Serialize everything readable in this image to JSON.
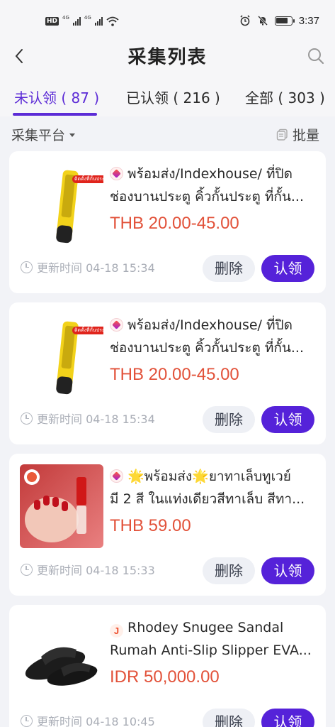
{
  "status_bar": {
    "hd": "HD",
    "net1": "4G",
    "net2": "4G",
    "time": "3:37",
    "battery_level": 0.8
  },
  "header": {
    "title": "采集列表",
    "back_icon": "chevron-left-icon",
    "search_icon": "search-icon"
  },
  "tabs": [
    {
      "label": "未认领 ( 87 )",
      "active": true
    },
    {
      "label": "已认领 ( 216 )",
      "active": false
    },
    {
      "label": "全部 ( 303 )",
      "active": false
    }
  ],
  "filter": {
    "platform_label": "采集平台",
    "batch_label": "批量"
  },
  "accent_color": "#5522d9",
  "price_color": "#e2523a",
  "items": [
    {
      "platform_icon": "lazada-icon",
      "title_line1": "พร้อมส่ง/Indexhouse/ ที่ปิด",
      "title_line2": "ช่องบานประตู คิ้วกั้นประตู ที่กั้น...",
      "price": "THB 20.00-45.00",
      "updated": "更新时间 04-18 15:34",
      "badge": "ติดตั้งที่กั้นประตู",
      "delete_label": "删除",
      "claim_label": "认领"
    },
    {
      "platform_icon": "lazada-icon",
      "title_line1": "พร้อมส่ง/Indexhouse/ ที่ปิด",
      "title_line2": "ช่องบานประตู คิ้วกั้นประตู ที่กั้น...",
      "price": "THB 20.00-45.00",
      "updated": "更新时间 04-18 15:34",
      "badge": "ติดตั้งที่กั้นประตู",
      "delete_label": "删除",
      "claim_label": "认领"
    },
    {
      "platform_icon": "lazada-icon",
      "title_line1": "🌟พร้อมส่ง🌟ยาทาเล็บทูเวย์",
      "title_line2": "มี 2 สี ในแท่งเดียวสีทาเล็บ สีทา...",
      "price": "THB 59.00",
      "updated": "更新时间 04-18 15:33",
      "delete_label": "删除",
      "claim_label": "认领"
    },
    {
      "platform_icon": "j-icon",
      "platform_letter": "J",
      "title_line1": "Rhodey Snugee Sandal",
      "title_line2": "Rumah Anti-Slip Slipper EVA...",
      "price": "IDR 50,000.00",
      "updated": "更新时间 04-18 10:45",
      "delete_label": "删除",
      "claim_label": "认领"
    }
  ]
}
